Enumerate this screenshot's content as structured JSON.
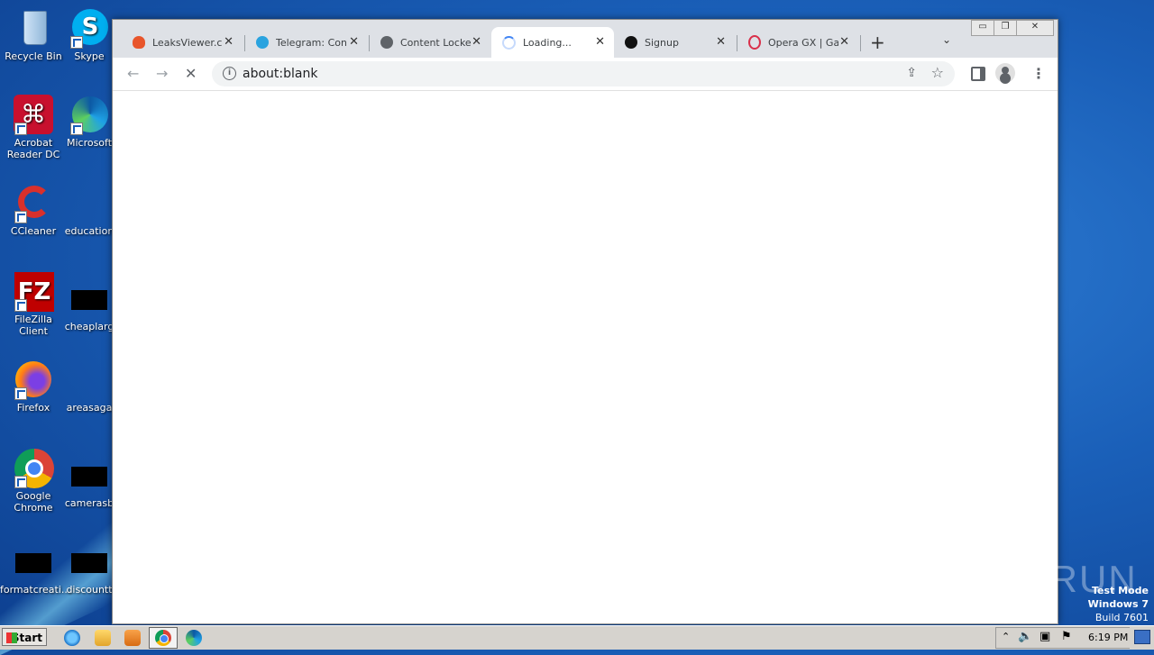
{
  "desktop": {
    "icons": [
      {
        "label": "Recycle Bin"
      },
      {
        "label": "Skype"
      },
      {
        "label": "Acrobat Reader DC"
      },
      {
        "label": "Microsoft"
      },
      {
        "label": "CCleaner"
      },
      {
        "label": "education"
      },
      {
        "label": "FileZilla Client"
      },
      {
        "label": "cheaplarg"
      },
      {
        "label": "Firefox"
      },
      {
        "label": "areasaga"
      },
      {
        "label": "Google Chrome"
      },
      {
        "label": "camerasb"
      },
      {
        "label": "formatcreati..."
      },
      {
        "label": "discountt"
      }
    ]
  },
  "browser": {
    "tabs": [
      {
        "title": "LeaksViewer.co",
        "favicon": "flame-icon",
        "color": "#e8552b"
      },
      {
        "title": "Telegram: Cont",
        "favicon": "telegram-icon",
        "color": "#2aa3df"
      },
      {
        "title": "Content Locker",
        "favicon": "globe-icon",
        "color": "#5f6368"
      },
      {
        "title": "Loading...",
        "favicon": "spinner-icon",
        "color": "#a8c7fa",
        "active": true
      },
      {
        "title": "Signup",
        "favicon": "x-logo-icon",
        "color": "#111111"
      },
      {
        "title": "Opera GX | Gar",
        "favicon": "opera-icon",
        "color": "#d9304a"
      }
    ],
    "close_glyph": "✕",
    "new_tab_glyph": "+",
    "tab_search_glyph": "⌄",
    "address": {
      "url": "about:blank"
    },
    "window_controls": {
      "minimize": "▭",
      "restore": "❐",
      "close": "✕"
    }
  },
  "watermark": {
    "text": "ANY▷RUN"
  },
  "test_mode": {
    "line1": "Test Mode",
    "line2": "Windows 7",
    "line3": "Build 7601"
  },
  "taskbar": {
    "start_label": "Start",
    "clock": "6:19 PM"
  }
}
